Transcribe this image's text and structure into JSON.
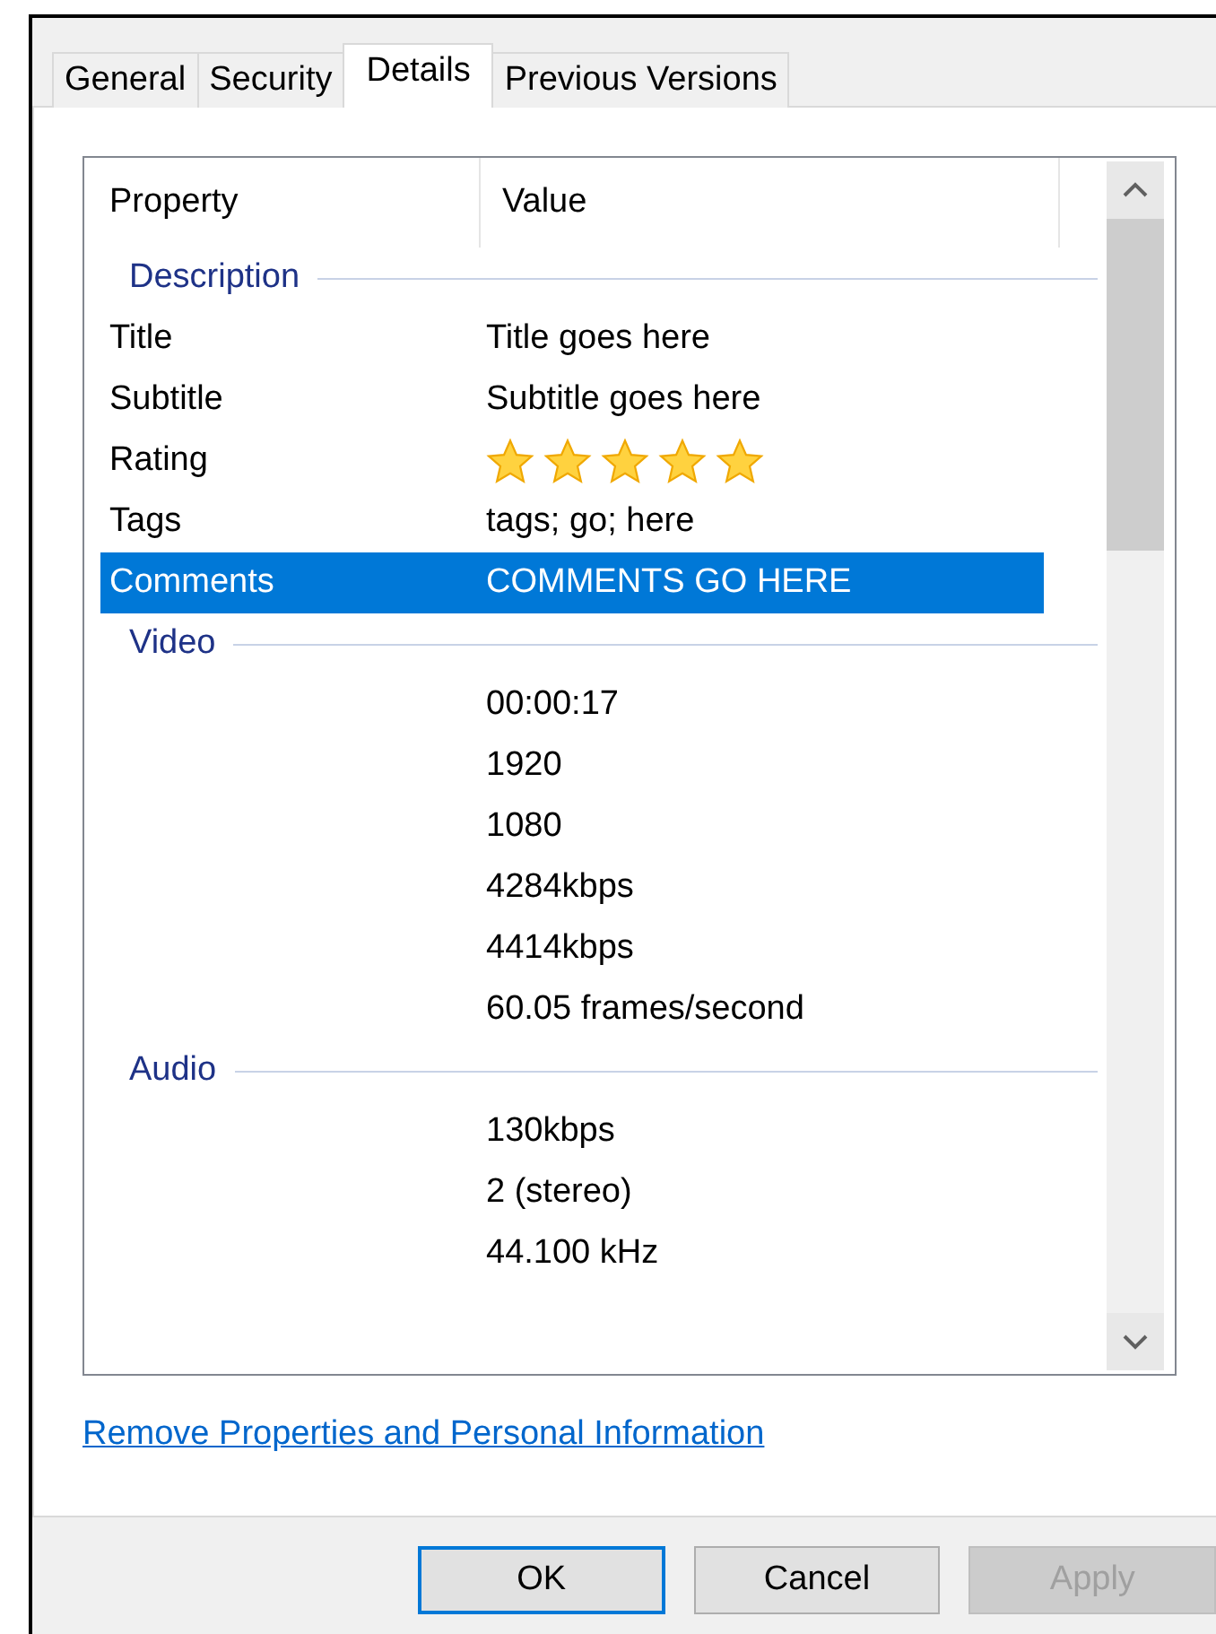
{
  "tabs": [
    {
      "label": "General",
      "selected": false
    },
    {
      "label": "Security",
      "selected": false
    },
    {
      "label": "Details",
      "selected": true
    },
    {
      "label": "Previous Versions",
      "selected": false
    }
  ],
  "columns": [
    "Property",
    "Value"
  ],
  "groups": [
    {
      "name": "Description",
      "rows": [
        {
          "property": "Title",
          "value": "Title goes here",
          "selected": false
        },
        {
          "property": "Subtitle",
          "value": "Subtitle goes here",
          "selected": false
        },
        {
          "property": "Rating",
          "kind": "stars",
          "stars": 5,
          "selected": false
        },
        {
          "property": "Tags",
          "value": "tags; go; here",
          "selected": false
        },
        {
          "property": "Comments",
          "value": "COMMENTS GO HERE",
          "selected": true
        }
      ]
    },
    {
      "name": "Video",
      "rows": [
        {
          "value": "00:00:17",
          "selected": false
        },
        {
          "value": "1920",
          "selected": false
        },
        {
          "value": "1080",
          "selected": false
        },
        {
          "value": "4284kbps",
          "selected": false
        },
        {
          "value": "4414kbps",
          "selected": false
        },
        {
          "value": "60.05 frames/second",
          "selected": false
        }
      ]
    },
    {
      "name": "Audio",
      "rows": [
        {
          "value": "130kbps",
          "selected": false
        },
        {
          "value": "2 (stereo)",
          "selected": false
        },
        {
          "value": "44.100 kHz",
          "selected": false
        }
      ]
    }
  ],
  "link": "Remove Properties and Personal Information",
  "buttons": [
    {
      "label": "OK",
      "default": true,
      "disabled": false
    },
    {
      "label": "Cancel",
      "default": false,
      "disabled": false
    },
    {
      "label": "Apply",
      "default": false,
      "disabled": true
    }
  ]
}
